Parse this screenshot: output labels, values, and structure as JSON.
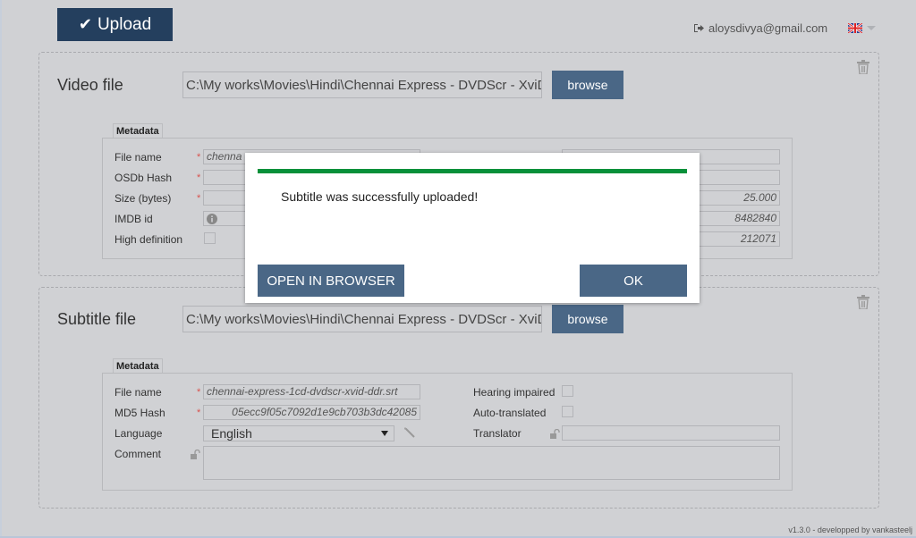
{
  "header": {
    "upload_label": "Upload",
    "upload_icon": "check-icon",
    "user_email": "aloysdivya@gmail.com",
    "logout_icon": "sign-out-icon",
    "language_flag": "uk-flag-icon"
  },
  "video": {
    "title": "Video file",
    "path": "C:\\My works\\Movies\\Hindi\\Chennai Express - DVDScr - XviD",
    "browse_label": "browse",
    "metadata_tab": "Metadata",
    "fields": {
      "file_name_label": "File name",
      "file_name_value": "chenna",
      "osdb_hash_label": "OSDb Hash",
      "osdb_hash_value": "",
      "size_label": "Size (bytes)",
      "size_value": "",
      "imdb_label": "IMDB id",
      "imdb_value": "",
      "hd_label": "High definition",
      "hd_checked": false,
      "right_values": [
        "",
        "",
        "25.000",
        "8482840",
        "212071"
      ]
    }
  },
  "subtitle": {
    "title": "Subtitle file",
    "path": "C:\\My works\\Movies\\Hindi\\Chennai Express - DVDScr - XviD",
    "browse_label": "browse",
    "metadata_tab": "Metadata",
    "fields": {
      "file_name_label": "File name",
      "file_name_value": "chennai-express-1cd-dvdscr-xvid-ddr.srt",
      "md5_label": "MD5 Hash",
      "md5_value": "05ecc9f05c7092d1e9cb703b3dc42085",
      "language_label": "Language",
      "language_value": "English",
      "comment_label": "Comment",
      "comment_value": "",
      "hearing_impaired_label": "Hearing impaired",
      "hearing_impaired_checked": false,
      "auto_translated_label": "Auto-translated",
      "auto_translated_checked": false,
      "translator_label": "Translator",
      "translator_value": ""
    }
  },
  "modal": {
    "message": "Subtitle was successfully uploaded!",
    "status_color": "#07903a",
    "open_in_browser_label": "OPEN IN BROWSER",
    "ok_label": "OK"
  },
  "footer": {
    "text": "v1.3.0 - developped by vankasteelj"
  }
}
